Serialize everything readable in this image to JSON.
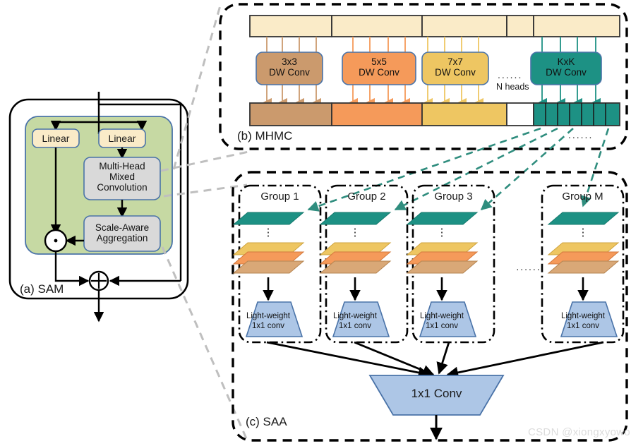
{
  "figure": {
    "watermark": "CSDN @xiongxyowo",
    "palette": {
      "green_panel": "#c6d9a3",
      "gray_box": "#d9d9d9",
      "cream": "#faebc8",
      "tan": "#cb9a6d",
      "orange": "#f59a5a",
      "yellow": "#eec662",
      "teal": "#1d9184",
      "blue": "#adc6e6",
      "blue_stroke": "#4a73a8",
      "dashed_black": "#000000",
      "dashed_gray": "#bfbfbf",
      "dashed_teal": "#2f8d7e"
    }
  },
  "panel_a": {
    "caption": "(a) SAM",
    "linear_left": "Linear",
    "linear_right": "Linear",
    "mhmc_box": [
      "Multi-Head",
      "Mixed",
      "Convolution"
    ],
    "saa_box": [
      "Scale-Aware",
      "Aggregation"
    ],
    "mul_symbol": "⊙",
    "add_symbol": "⊕"
  },
  "panel_b": {
    "caption": "(b) MHMC",
    "heads_label": "N heads",
    "ellipsis": "......",
    "ellipsis_below": "......",
    "heads": [
      {
        "kernel": "3x3",
        "line2": "DW Conv",
        "color": "#cb9a6d"
      },
      {
        "kernel": "5x5",
        "line2": "DW Conv",
        "color": "#f59a5a"
      },
      {
        "kernel": "7x7",
        "line2": "DW Conv",
        "color": "#eec662"
      },
      {
        "kernel": "KxK",
        "line2": "DW Conv",
        "color": "#1d9184"
      }
    ],
    "input_segments": [
      116,
      128,
      120,
      38,
      122
    ],
    "output_segments": [
      116,
      128,
      120,
      38,
      122
    ],
    "output_colors": [
      "#cb9a6d",
      "#f59a5a",
      "#eec662",
      "#ffffff",
      "#1d9184"
    ],
    "kxk_subcells": 7
  },
  "panel_c": {
    "caption": "(c) SAA",
    "ellipsis": "......",
    "groups": [
      {
        "title": "Group 1",
        "conv": [
          "Light-weight",
          "1x1 conv"
        ]
      },
      {
        "title": "Group 2",
        "conv": [
          "Light-weight",
          "1x1 conv"
        ]
      },
      {
        "title": "Group 3",
        "conv": [
          "Light-weight",
          "1x1 conv"
        ]
      },
      {
        "title": "Group M",
        "conv": [
          "Light-weight",
          "1x1 conv"
        ]
      }
    ],
    "layer_colors": [
      "#1d9184",
      "#eec662",
      "#f59a5a",
      "#d9a877"
    ],
    "vertical_dots": "⋮",
    "final_conv": "1x1 Conv"
  }
}
